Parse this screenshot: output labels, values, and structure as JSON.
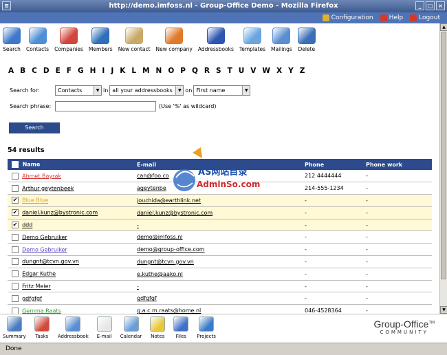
{
  "window": {
    "title": "http://demo.imfoss.nl - Group-Office Demo - Mozilla Firefox"
  },
  "topbar": {
    "links": [
      {
        "label": "Configuration",
        "icon": "wrench-icon",
        "color": "#e0b030"
      },
      {
        "label": "Help",
        "icon": "help-icon",
        "color": "#d23a2a"
      },
      {
        "label": "Logout",
        "icon": "logout-icon",
        "color": "#d23a2a"
      }
    ]
  },
  "toolbar": {
    "items": [
      {
        "label": "Search",
        "icon": "search-icon",
        "color": "#3f78c8"
      },
      {
        "label": "Contacts",
        "icon": "contacts-icon",
        "color": "#4d8fd6"
      },
      {
        "label": "Companies",
        "icon": "companies-icon",
        "color": "#d1463a"
      },
      {
        "label": "Members",
        "icon": "members-icon",
        "color": "#2e6fb8"
      },
      {
        "label": "New contact",
        "icon": "new-contact-icon",
        "color": "#c9a968"
      },
      {
        "label": "New company",
        "icon": "new-company-icon",
        "color": "#e07a2a"
      },
      {
        "label": "Addressbooks",
        "icon": "addressbooks-icon",
        "color": "#2c56b0"
      },
      {
        "label": "Templates",
        "icon": "templates-icon",
        "color": "#6aa5e0"
      },
      {
        "label": "Mailings",
        "icon": "mailings-icon",
        "color": "#5a8ed0"
      },
      {
        "label": "Delete",
        "icon": "delete-icon",
        "color": "#3b6fb6"
      }
    ]
  },
  "alphabet": [
    "A",
    "B",
    "C",
    "D",
    "E",
    "F",
    "G",
    "H",
    "I",
    "J",
    "K",
    "L",
    "M",
    "N",
    "O",
    "P",
    "Q",
    "R",
    "S",
    "T",
    "U",
    "V",
    "W",
    "X",
    "Y",
    "Z"
  ],
  "search": {
    "search_for_label": "Search for:",
    "type_value": "Contacts",
    "in_label": "in",
    "scope_value": "all your addressbooks",
    "on_label": "on",
    "field_value": "First name",
    "phrase_label": "Search phrase:",
    "phrase_value": "",
    "wildcard_hint": "(Use '%' as wildcard)",
    "button_label": "Search"
  },
  "results": {
    "count_label": "54 results",
    "columns": [
      "Name",
      "E-mail",
      "Phone",
      "Phone work"
    ],
    "rows": [
      {
        "name": "Ahmet Bayrak",
        "email": "can@foo.co",
        "phone": "212 4444444",
        "phone_work": "-",
        "checked": false,
        "highlight": false,
        "name_color": "#d43a3a"
      },
      {
        "name": "Arthur geytenbeek",
        "email": "ageytenbe",
        "phone": "214-555-1234",
        "phone_work": "-",
        "checked": false,
        "highlight": false,
        "name_color": "#000000"
      },
      {
        "name": "Blue Blue",
        "email": "jouchida@earthlink.net",
        "phone": "-",
        "phone_work": "-",
        "checked": true,
        "highlight": true,
        "name_color": "#e0a020"
      },
      {
        "name": "daniel.kunz@bystronic.com",
        "email": "daniel.kunz@bystronic.com",
        "phone": "-",
        "phone_work": "-",
        "checked": true,
        "highlight": true,
        "name_color": "#000000"
      },
      {
        "name": "ddd",
        "email": "-",
        "phone": "-",
        "phone_work": "-",
        "checked": true,
        "highlight": true,
        "name_color": "#000000"
      },
      {
        "name": "Demo Gebruiker",
        "email": "demo@imfoss.nl",
        "phone": "-",
        "phone_work": "-",
        "checked": false,
        "highlight": false,
        "name_color": "#000000"
      },
      {
        "name": "Demo Gebruiker",
        "email": "demo@group-office.com",
        "phone": "-",
        "phone_work": "-",
        "checked": false,
        "highlight": false,
        "name_color": "#5a3fc0"
      },
      {
        "name": "dungnt@tcvn.gov.vn",
        "email": "dungnt@tcvn.gov.vn",
        "phone": "-",
        "phone_work": "-",
        "checked": false,
        "highlight": false,
        "name_color": "#000000"
      },
      {
        "name": "Edgar Kuthe",
        "email": "e.kuthe@aako.nl",
        "phone": "-",
        "phone_work": "-",
        "checked": false,
        "highlight": false,
        "name_color": "#000000"
      },
      {
        "name": "Fritz Meier",
        "email": "-",
        "phone": "-",
        "phone_work": "-",
        "checked": false,
        "highlight": false,
        "name_color": "#000000"
      },
      {
        "name": "gdfgfgf",
        "email": "gdfgfgf",
        "phone": "-",
        "phone_work": "-",
        "checked": false,
        "highlight": false,
        "name_color": "#000000"
      },
      {
        "name": "Gemma Raats",
        "email": "g.a.c.m.raats@home.nl",
        "phone": "046-4528364",
        "phone_work": "-",
        "checked": false,
        "highlight": false,
        "name_color": "#2e9a2e"
      }
    ]
  },
  "watermark": {
    "line1": "AS网站目录",
    "line2": "AdminSo.com"
  },
  "dock": {
    "items": [
      {
        "label": "Summary",
        "icon": "summary-icon",
        "color": "#4a7cc0"
      },
      {
        "label": "Tasks",
        "icon": "tasks-icon",
        "color": "#d24a3a"
      },
      {
        "label": "Addressbook",
        "icon": "addressbook-icon",
        "color": "#5a8ed0"
      },
      {
        "label": "E-mail",
        "icon": "email-icon",
        "color": "#e7e7e7"
      },
      {
        "label": "Calendar",
        "icon": "calendar-icon",
        "color": "#6a9ed8"
      },
      {
        "label": "Notes",
        "icon": "notes-icon",
        "color": "#e8c838"
      },
      {
        "label": "Files",
        "icon": "files-icon",
        "color": "#3f70c8"
      },
      {
        "label": "Projects",
        "icon": "projects-icon",
        "color": "#3a7ac8"
      }
    ],
    "brand": "Group-Office",
    "brand_tm": "TM",
    "brand_sub": "COMMUNITY"
  },
  "statusbar": {
    "text": "Done"
  }
}
